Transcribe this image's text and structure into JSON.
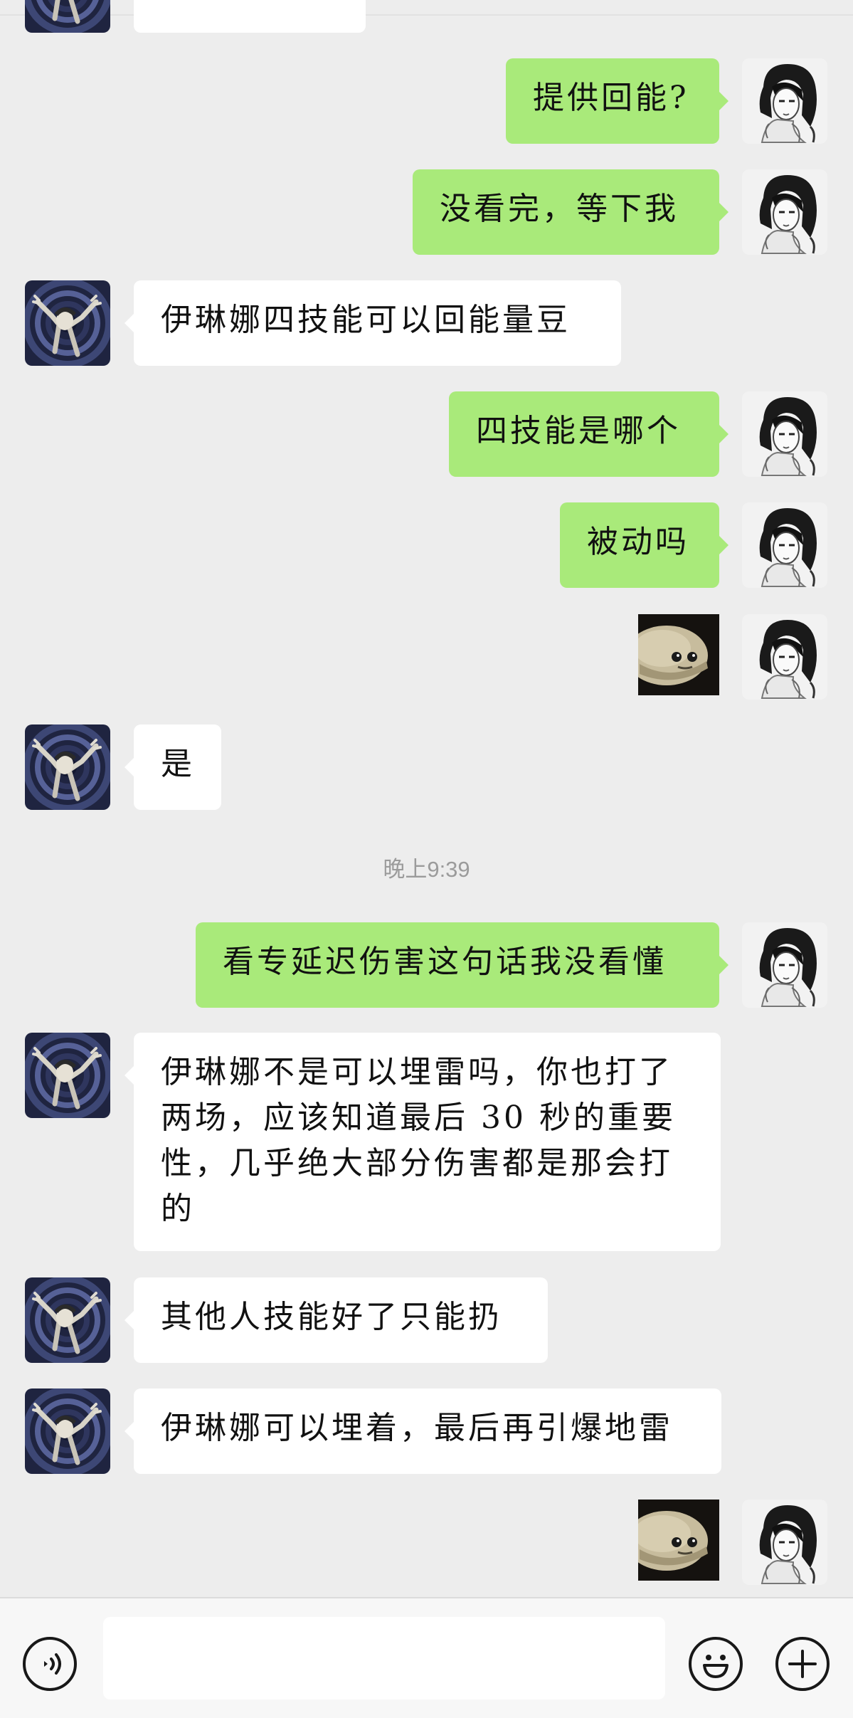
{
  "conversation": {
    "messages": [
      {
        "from": "me",
        "text": "提供回能?"
      },
      {
        "from": "me",
        "text": "没看完，等下我"
      },
      {
        "from": "other",
        "text": "伊琳娜四技能可以回能量豆"
      },
      {
        "from": "me",
        "text": "四技能是哪个"
      },
      {
        "from": "me",
        "text": "被动吗"
      },
      {
        "from": "me",
        "sticker": "shark-face-sticker"
      },
      {
        "from": "other",
        "text": "是"
      },
      {
        "time": "晚上9:39"
      },
      {
        "from": "me",
        "text": "看专延迟伤害这句话我没看懂"
      },
      {
        "from": "other",
        "lines": [
          "伊琳娜不是可以埋雷吗，你也打了",
          "两场，应该知道最后 30 秒的重要",
          "性，几乎绝大部分伤害都是那会打",
          "的"
        ]
      },
      {
        "from": "other",
        "text": "其他人技能好了只能扔"
      },
      {
        "from": "other",
        "text": "伊琳娜可以埋着，最后再引爆地雷"
      },
      {
        "from": "me",
        "sticker": "shark-face-sticker"
      }
    ]
  },
  "input_bar": {
    "message_value": "",
    "icons": [
      "voice-icon",
      "emoji-icon",
      "plus-icon"
    ]
  },
  "colors": {
    "background": "#ededed",
    "bubble_out": "#a9ea7a",
    "bubble_in": "#ffffff",
    "timestamp": "#9b9b9b"
  }
}
